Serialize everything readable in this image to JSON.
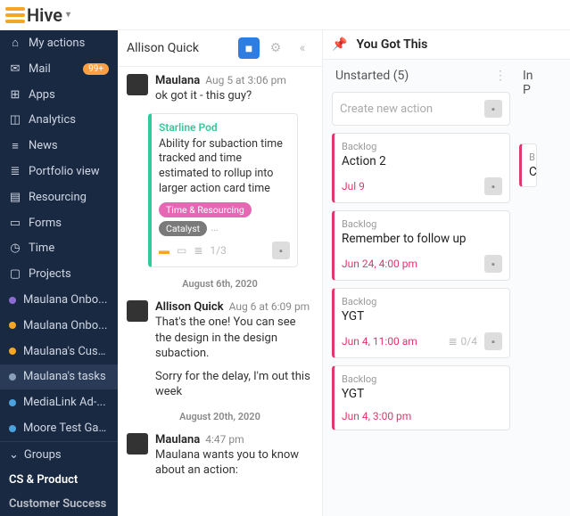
{
  "brand": "Hive",
  "sidebar": {
    "items": [
      {
        "label": "My actions"
      },
      {
        "label": "Mail",
        "badge": "99+"
      },
      {
        "label": "Apps"
      },
      {
        "label": "Analytics"
      },
      {
        "label": "News"
      },
      {
        "label": "Portfolio view"
      },
      {
        "label": "Resourcing"
      },
      {
        "label": "Forms"
      },
      {
        "label": "Time"
      },
      {
        "label": "Projects"
      }
    ],
    "projects": [
      {
        "label": "Maulana Onbo...",
        "color": "#8e6bd4"
      },
      {
        "label": "Maulana Onbo...",
        "color": "#f5a623"
      },
      {
        "label": "Maulana's Cust...",
        "color": "#f5a623"
      },
      {
        "label": "Maulana's tasks",
        "color": "#8aa0b8",
        "active": true
      },
      {
        "label": "MediaLink Ad-...",
        "color": "#4aa3df"
      },
      {
        "label": "Moore Test Gantt",
        "color": "#4aa3df"
      }
    ],
    "groups_header": "Groups",
    "groups": [
      "CS & Product",
      "Customer Success"
    ]
  },
  "chat": {
    "title": "Allison Quick",
    "messages": [
      {
        "name": "Maulana",
        "time": "Aug 5 at 3:06 pm",
        "text": "ok got it - this guy?"
      }
    ],
    "card": {
      "title": "Starline Pod",
      "body": "Ability for subaction time tracked and time estimated to rollup into larger action card time",
      "tags": [
        "Time & Resourcing",
        "Catalyst"
      ],
      "count": "1/3"
    },
    "date1": "August 6th, 2020",
    "msg2": {
      "name": "Allison Quick",
      "time": "Aug 6 at 6:09 pm",
      "text1": "That's the one! You can see the design in the design subaction.",
      "text2": "Sorry for the delay, I'm out this week"
    },
    "date2": "August 20th, 2020",
    "msg3": {
      "name": "Maulana",
      "time": "4:47 pm",
      "text": "Maulana wants you to know about an action:"
    }
  },
  "board": {
    "title": "You Got This",
    "list1": {
      "title": "Unstarted (5)",
      "new_placeholder": "Create new action",
      "cards": [
        {
          "status": "Backlog",
          "title": "Action 2",
          "date": "Jul 9"
        },
        {
          "status": "Backlog",
          "title": "Remember to follow up",
          "date": "Jun 24, 4:00 pm"
        },
        {
          "status": "Backlog",
          "title": "YGT",
          "date": "Jun 4, 11:00 am",
          "sub": "0/4"
        },
        {
          "status": "Backlog",
          "title": "YGT",
          "date": "Jun 4, 3:00 pm"
        }
      ]
    },
    "list2": {
      "title": "In P",
      "card_status": "B",
      "card_title": "C"
    }
  }
}
